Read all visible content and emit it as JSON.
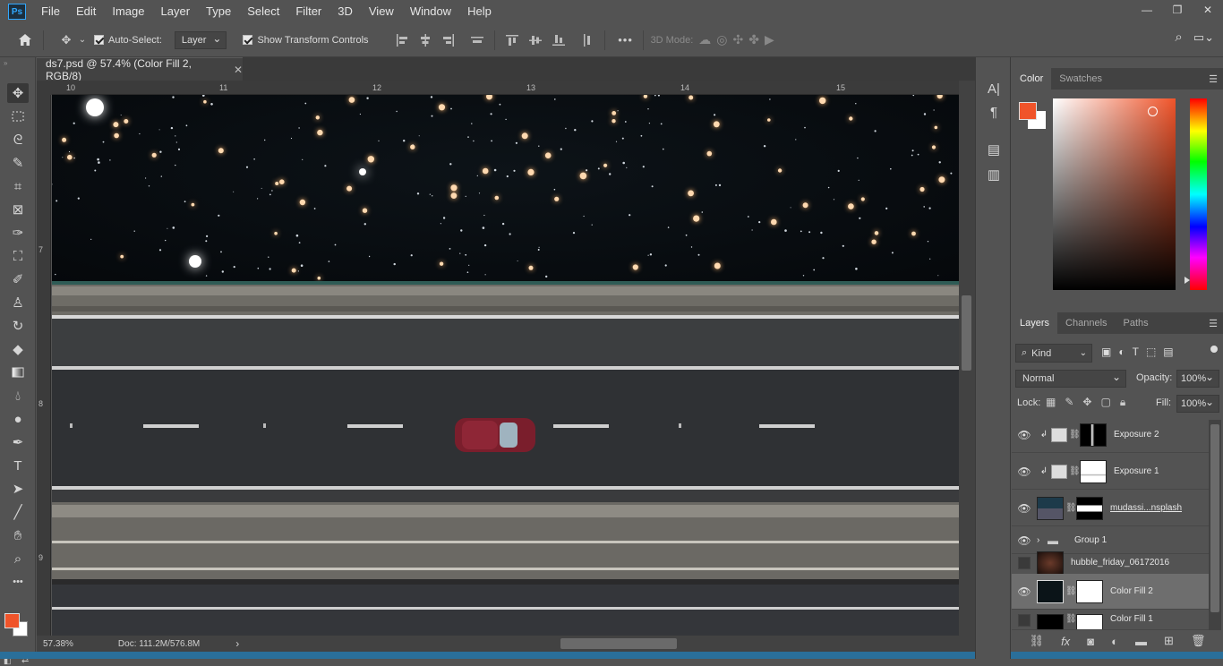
{
  "app": {
    "logo": "Ps"
  },
  "menu": [
    "File",
    "Edit",
    "Image",
    "Layer",
    "Type",
    "Select",
    "Filter",
    "3D",
    "View",
    "Window",
    "Help"
  ],
  "window_controls": {
    "minimize": "—",
    "restore": "❐",
    "close": "✕"
  },
  "options": {
    "auto_select_label": "Auto-Select:",
    "auto_select_value": "Layer",
    "show_transform_label": "Show Transform Controls",
    "threed_mode_label": "3D Mode:",
    "more_label": "•••"
  },
  "document": {
    "tab_title": "ds7.psd @ 57.4% (Color Fill 2, RGB/8)",
    "close": "✕",
    "ruler_top": [
      "10",
      "11",
      "12",
      "13",
      "14",
      "15"
    ],
    "ruler_left": [
      "7",
      "8",
      "9"
    ]
  },
  "status": {
    "zoom": "57.38%",
    "doc": "Doc: 111.2M/576.8M",
    "arrow": "›"
  },
  "color_panel": {
    "tabs": [
      "Color",
      "Swatches"
    ],
    "foreground": "#f0542a",
    "background": "#ffffff"
  },
  "layers_panel": {
    "tabs": [
      "Layers",
      "Channels",
      "Paths"
    ],
    "filter_kind": "Kind",
    "blend_mode": "Normal",
    "opacity_label": "Opacity:",
    "opacity_value": "100%",
    "lock_label": "Lock:",
    "fill_label": "Fill:",
    "fill_value": "100%",
    "layers": [
      {
        "name": "Exposure 2",
        "visible": true
      },
      {
        "name": "Exposure 1",
        "visible": true
      },
      {
        "name": "mudassi...nsplash",
        "visible": true
      },
      {
        "name": "Group 1",
        "visible": true
      },
      {
        "name": "hubble_friday_06172016",
        "visible": false
      },
      {
        "name": "Color Fill 2",
        "visible": true,
        "selected": true
      },
      {
        "name": "Color Fill 1",
        "visible": false
      }
    ]
  }
}
